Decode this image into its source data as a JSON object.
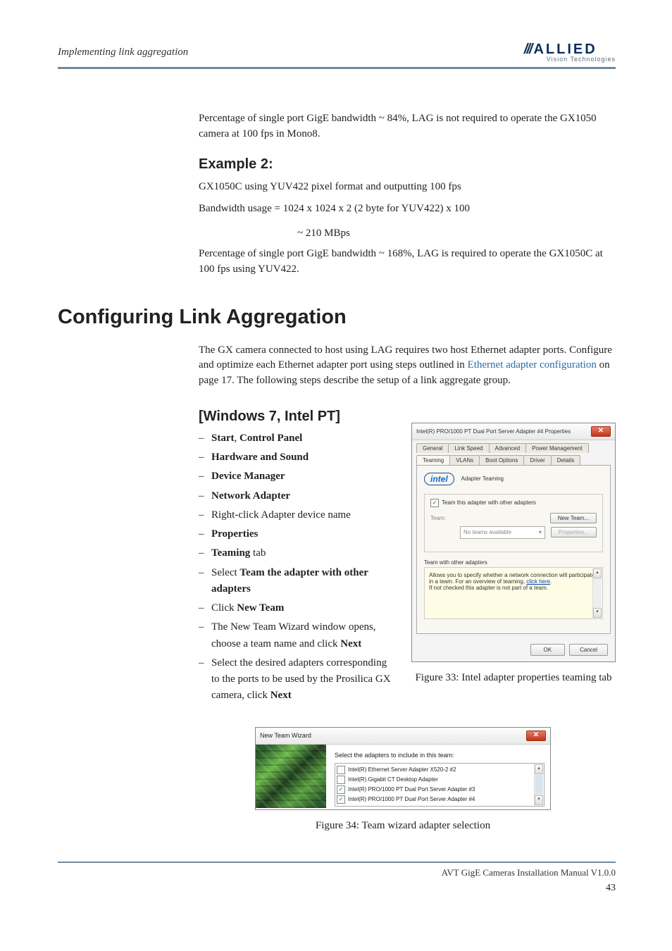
{
  "header": {
    "section_title": "Implementing link aggregation",
    "logo_top": "ALLIED",
    "logo_bottom": "Vision Technologies"
  },
  "intro": {
    "p1": "Percentage of single port GigE bandwidth ~ 84%, LAG is not required to operate the GX1050 camera at 100 fps in Mono8."
  },
  "example2": {
    "heading": "Example 2:",
    "line1": "GX1050C using YUV422 pixel format and outputting 100 fps",
    "line2": "Bandwidth usage = 1024 x 1024 x 2 (2 byte for YUV422) x 100",
    "line3": "~ 210 MBps",
    "line4": "Percentage of single port GigE bandwidth ~ 168%, LAG is required to operate the GX1050C at 100 fps using YUV422."
  },
  "h1": "Configuring Link Aggregation",
  "config_intro_pre": "The GX camera connected to host using LAG requires two host Ethernet adapter ports. Configure and optimize each Ethernet adapter port using steps outlined in ",
  "config_intro_link": "Ethernet adapter configuration",
  "config_intro_post": " on page 17.   The following steps describe the setup of a link aggregate group.",
  "win_heading": "[Windows 7, Intel PT]",
  "steps": [
    [
      [
        "b",
        "Start"
      ],
      [
        "t",
        ", "
      ],
      [
        "b",
        "Control Panel"
      ]
    ],
    [
      [
        "b",
        "Hardware and Sound"
      ]
    ],
    [
      [
        "b",
        "Device Manager"
      ]
    ],
    [
      [
        "b",
        "Network Adapter"
      ]
    ],
    [
      [
        "t",
        "Right-click Adapter device name"
      ]
    ],
    [
      [
        "b",
        "Properties"
      ]
    ],
    [
      [
        "b",
        "Teaming"
      ],
      [
        "t",
        " tab"
      ]
    ],
    [
      [
        "t",
        "Select "
      ],
      [
        "b",
        "Team the adapter with other adapters"
      ]
    ],
    [
      [
        "t",
        "Click "
      ],
      [
        "b",
        "New Team"
      ]
    ],
    [
      [
        "t",
        "The New Team Wizard window opens, choose a team name and click "
      ],
      [
        "b",
        "Next"
      ]
    ],
    [
      [
        "t",
        "Select the desired adapters corresponding to the ports to be used by the Prosilica GX camera, click "
      ],
      [
        "b",
        "Next"
      ]
    ]
  ],
  "props_dialog": {
    "title": "Intel(R) PRO/1000 PT Dual Port Server Adapter #4 Properties",
    "tabs_row1": [
      "General",
      "Link Speed",
      "Advanced",
      "Power Management"
    ],
    "tabs_row2": [
      "Teaming",
      "VLANs",
      "Boot Options",
      "Driver",
      "Details"
    ],
    "adapter_teaming_label": "Adapter Teaming",
    "team_checkbox": "Team this adapter with other adapters",
    "team_label": "Team:",
    "team_dropdown": "No teams available",
    "new_team_btn": "New Team...",
    "properties_btn": "Properties...",
    "group_label": "Team with other adapters",
    "desc_1": "Allows you to specify whether a network connection will participate in a team. For an overview of teaming, ",
    "desc_link": "click here",
    "desc_2": ".",
    "desc_3": "If not checked this adapter is not part of a team.",
    "ok": "OK",
    "cancel": "Cancel"
  },
  "fig33": "Figure 33: Intel adapter properties teaming tab",
  "wizard": {
    "title": "New Team Wizard",
    "instruction": "Select the adapters to include in this team:",
    "adapters": [
      {
        "checked": false,
        "name": "Intel(R) Ethernet Server Adapter X520-2 #2"
      },
      {
        "checked": false,
        "name": "Intel(R) Gigabit CT Desktop Adapter"
      },
      {
        "checked": true,
        "name": "Intel(R) PRO/1000 PT Dual Port Server Adapter #3"
      },
      {
        "checked": true,
        "name": "Intel(R) PRO/1000 PT Dual Port Server Adapter #4"
      }
    ]
  },
  "fig34": "Figure 34: Team wizard adapter selection",
  "footer": {
    "manual": "AVT GigE Cameras Installation Manual V1.0.0",
    "page": "43"
  }
}
